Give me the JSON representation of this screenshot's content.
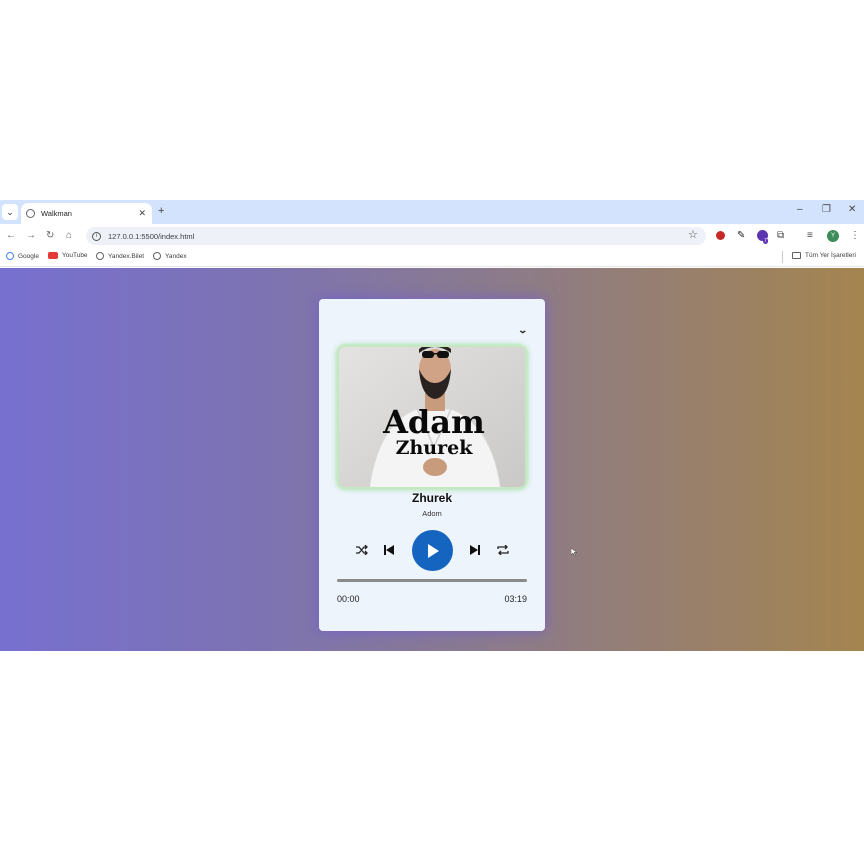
{
  "browser": {
    "tab_title": "Walkman",
    "url": "127.0.0.1:5500/index.html",
    "bookmarks": [
      "Google",
      "YouTube",
      "Yandex.Bilet",
      "Yandex"
    ],
    "all_bookmarks_label": "Tüm Yer İşaretleri",
    "profile_initial": "Y",
    "extension_badge": "7"
  },
  "player": {
    "cover_line1": "Adam",
    "cover_line2": "Zhurek",
    "song_title": "Zhurek",
    "artist": "Adom",
    "current_time": "00:00",
    "duration": "03:19",
    "progress": 0
  },
  "icons": [
    "chevron-down-icon",
    "shuffle-icon",
    "previous-icon",
    "play-icon",
    "next-icon",
    "repeat-icon"
  ],
  "colors": {
    "play_button": "#1565c0",
    "gradient_left": "#7770cf",
    "gradient_right": "#a4854f",
    "card": "#eef4fc"
  }
}
